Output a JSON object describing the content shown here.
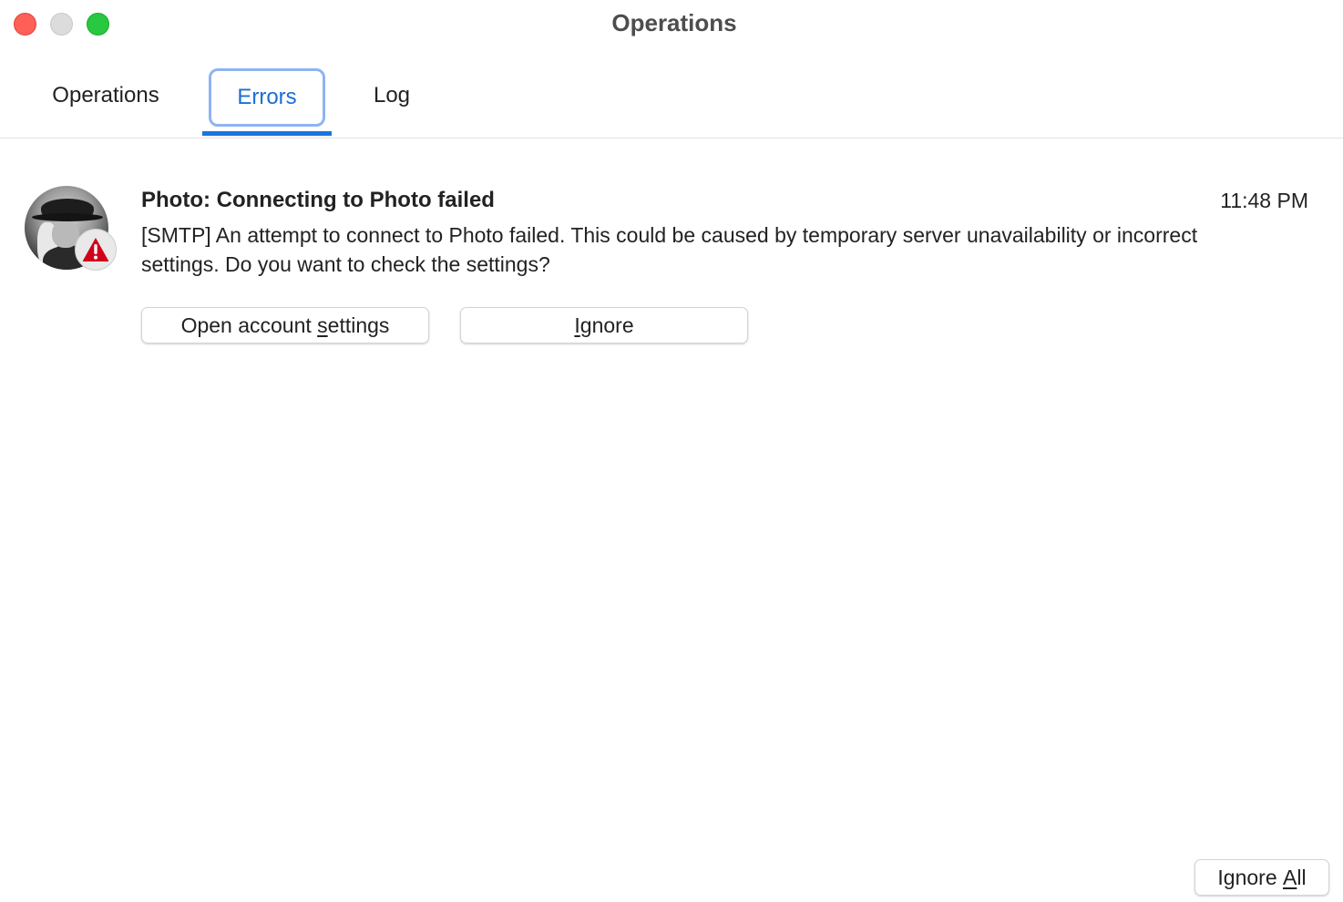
{
  "window": {
    "title": "Operations"
  },
  "tabs": [
    {
      "label": "Operations",
      "selected": false
    },
    {
      "label": "Errors",
      "selected": true
    },
    {
      "label": "Log",
      "selected": false
    }
  ],
  "error_item": {
    "title": "Photo: Connecting to Photo failed",
    "time": "11:48 PM",
    "message": "[SMTP] An attempt to connect to Photo failed. This could be caused by temporary server unavailability or incorrect settings. Do you want to check the settings?",
    "badge_icon": "warning-icon",
    "buttons": {
      "open_settings": {
        "before": "Open account ",
        "mnemonic": "s",
        "after": "ettings"
      },
      "ignore": {
        "before": "",
        "mnemonic": "I",
        "after": "gnore"
      }
    }
  },
  "footer": {
    "ignore_all": {
      "before": "Ignore ",
      "mnemonic": "A",
      "after": "ll"
    }
  },
  "colors": {
    "accent": "#1a76e0",
    "focus_ring": "#8fb3f3",
    "warning": "#d0021b",
    "close": "#fe5f57",
    "maximize": "#28c840"
  }
}
